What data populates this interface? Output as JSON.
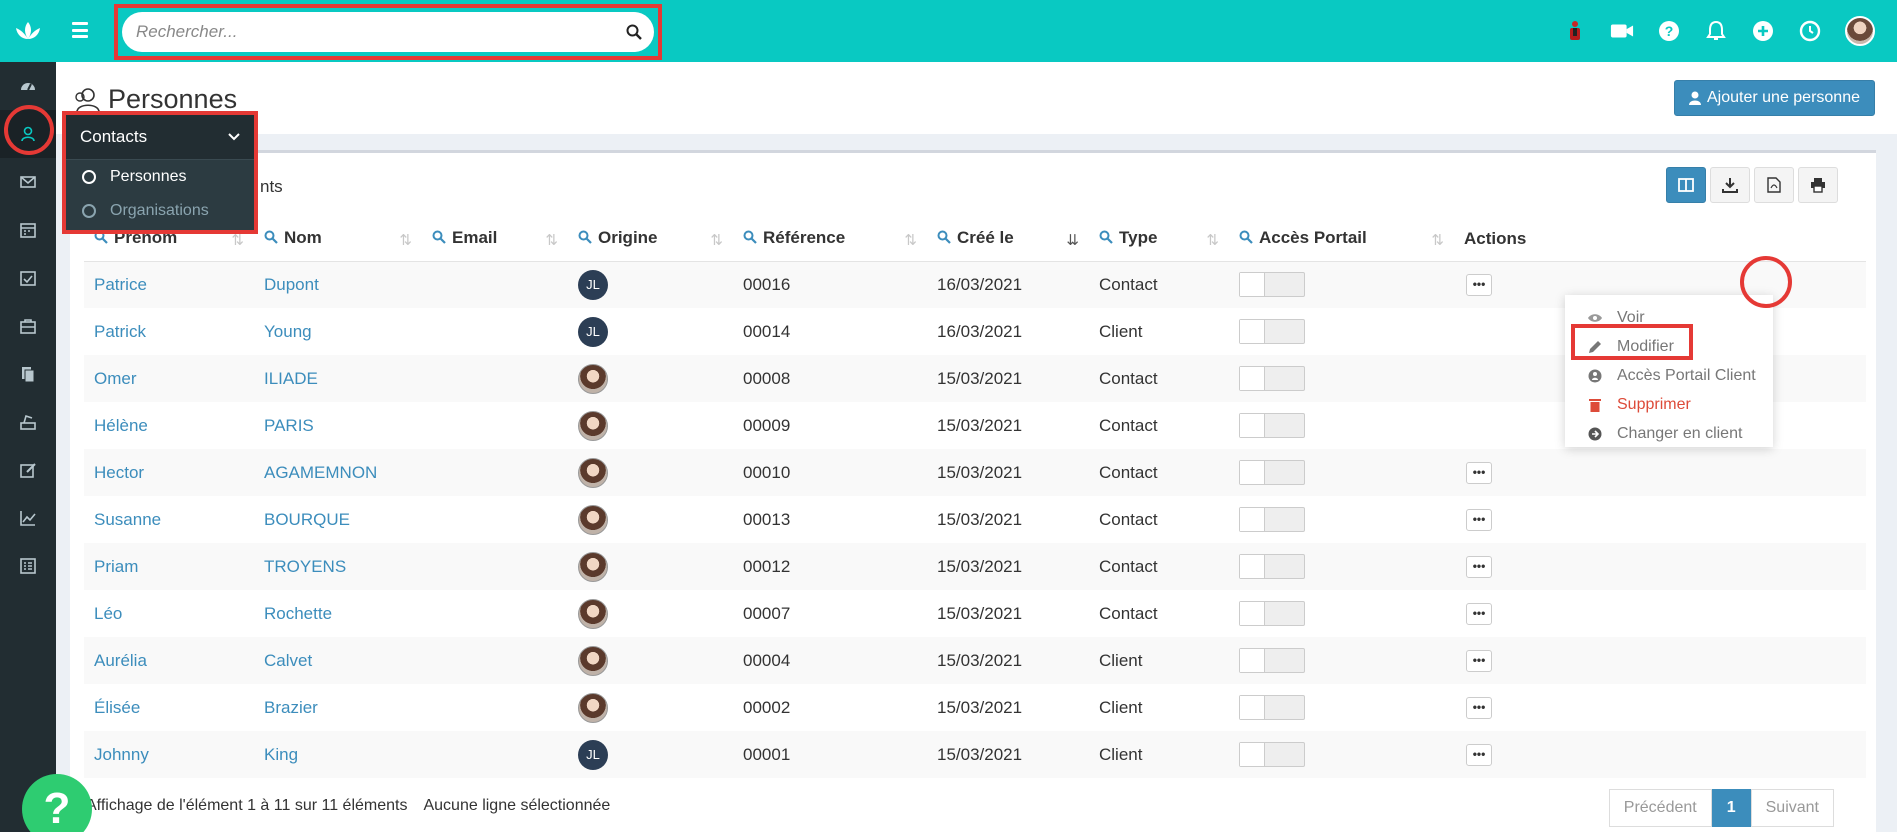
{
  "topbar": {
    "search_placeholder": "Rechercher..."
  },
  "page": {
    "title": "Personnes",
    "add_button": "Ajouter une personne",
    "length_info": "nts"
  },
  "submenu": {
    "title": "Contacts",
    "items": [
      {
        "label": "Personnes",
        "active": true
      },
      {
        "label": "Organisations",
        "active": false
      }
    ]
  },
  "table": {
    "columns": [
      "Prénom",
      "Nom",
      "Email",
      "Origine",
      "Référence",
      "Créé le",
      "Type",
      "Accès Portail",
      "Actions"
    ],
    "rows": [
      {
        "prenom": "Patrice",
        "nom": "Dupont",
        "email": "",
        "origine": "JL",
        "reference": "00016",
        "cree_le": "16/03/2021",
        "type": "Contact",
        "portail": false
      },
      {
        "prenom": "Patrick",
        "nom": "Young",
        "email": "",
        "origine": "JL",
        "reference": "00014",
        "cree_le": "16/03/2021",
        "type": "Client",
        "portail": false
      },
      {
        "prenom": "Omer",
        "nom": "ILIADE",
        "email": "",
        "origine": "photo",
        "reference": "00008",
        "cree_le": "15/03/2021",
        "type": "Contact",
        "portail": false
      },
      {
        "prenom": "Hélène",
        "nom": "PARIS",
        "email": "",
        "origine": "photo",
        "reference": "00009",
        "cree_le": "15/03/2021",
        "type": "Contact",
        "portail": false
      },
      {
        "prenom": "Hector",
        "nom": "AGAMEMNON",
        "email": "",
        "origine": "photo",
        "reference": "00010",
        "cree_le": "15/03/2021",
        "type": "Contact",
        "portail": false
      },
      {
        "prenom": "Susanne",
        "nom": "BOURQUE",
        "email": "",
        "origine": "photo",
        "reference": "00013",
        "cree_le": "15/03/2021",
        "type": "Contact",
        "portail": false
      },
      {
        "prenom": "Priam",
        "nom": "TROYENS",
        "email": "",
        "origine": "photo",
        "reference": "00012",
        "cree_le": "15/03/2021",
        "type": "Contact",
        "portail": false
      },
      {
        "prenom": "Léo",
        "nom": "Rochette",
        "email": "",
        "origine": "photo",
        "reference": "00007",
        "cree_le": "15/03/2021",
        "type": "Contact",
        "portail": false
      },
      {
        "prenom": "Aurélia",
        "nom": "Calvet",
        "email": "",
        "origine": "photo",
        "reference": "00004",
        "cree_le": "15/03/2021",
        "type": "Client",
        "portail": false
      },
      {
        "prenom": "Élisée",
        "nom": "Brazier",
        "email": "",
        "origine": "photo",
        "reference": "00002",
        "cree_le": "15/03/2021",
        "type": "Client",
        "portail": false
      },
      {
        "prenom": "Johnny",
        "nom": "King",
        "email": "",
        "origine": "JL",
        "reference": "00001",
        "cree_le": "15/03/2021",
        "type": "Client",
        "portail": false
      }
    ]
  },
  "dropdown": {
    "items": [
      {
        "label": "Voir",
        "icon": "eye-icon"
      },
      {
        "label": "Modifier",
        "icon": "pencil-icon"
      },
      {
        "label": "Accès Portail Client",
        "icon": "portal-icon"
      },
      {
        "label": "Supprimer",
        "icon": "trash-icon"
      },
      {
        "label": "Changer en client",
        "icon": "arrow-circle-icon"
      }
    ]
  },
  "footer": {
    "info": "Affichage de l'élément 1 à 11 sur 11 éléments",
    "selection": "Aucune ligne sélectionnée",
    "prev": "Précédent",
    "page": "1",
    "next": "Suivant"
  },
  "help": {
    "label": "?"
  },
  "colors": {
    "accent": "#09c9c2",
    "sidebar": "#222d32",
    "link": "#3c8dbc",
    "highlight": "#e53935",
    "danger": "#dd4b39"
  }
}
